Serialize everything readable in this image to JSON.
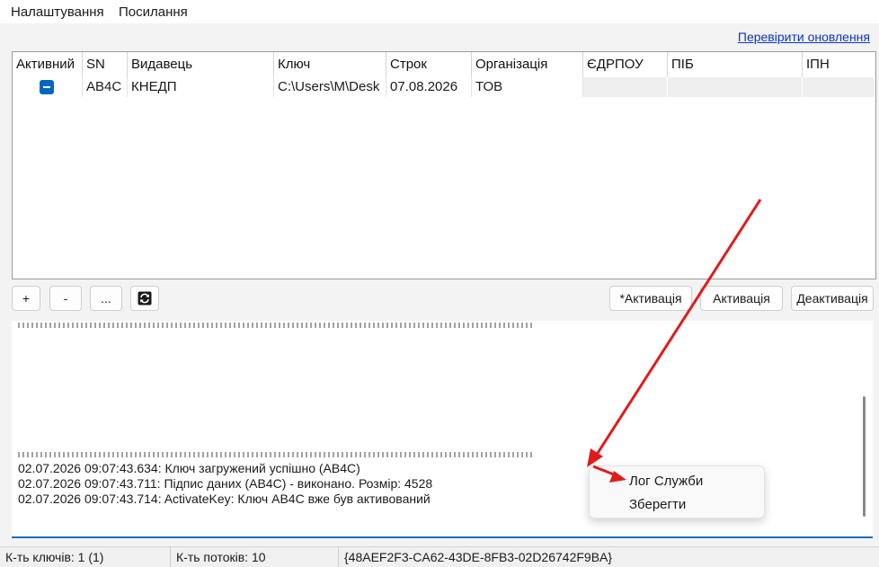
{
  "menubar": {
    "items": [
      "Налаштування",
      "Посилання"
    ]
  },
  "check_updates_link": "Перевірити оновлення",
  "table": {
    "columns": [
      "Активний",
      "SN",
      "Видавець",
      "Ключ",
      "Строк",
      "Організація",
      "ЄДРПОУ",
      "ПІБ",
      "ІПН"
    ],
    "rows": [
      {
        "sn": "AB4C",
        "issuer": "КНЕДП",
        "key": "C:\\Users\\M\\Desk",
        "expires": "07.08.2026",
        "org": "ТОВ"
      }
    ]
  },
  "buttons": {
    "add": "+",
    "remove": "-",
    "more": "...",
    "activate_star": "*Активація",
    "activate": "Активація",
    "deactivate": "Деактивація"
  },
  "log": {
    "lines": [
      "02.07.2026 09:07:43.634: Ключ загружений успішно (AB4C)",
      "02.07.2026 09:07:43.711: Підпис даних (AB4C) - виконано. Розмір: 4528",
      "02.07.2026 09:07:43.714: ActivateKey: Ключ AB4C вже був активований"
    ]
  },
  "context_menu": {
    "items": [
      "Лог Служби",
      "Зберегти"
    ]
  },
  "statusbar": {
    "keys": "К-ть ключів: 1 (1)",
    "threads": "К-ть потоків: 10",
    "guid": "{48AEF2F3-CA62-43DE-8FB3-02D26742F9BA}"
  },
  "colors": {
    "accent": "#0067c0",
    "link": "#0a34c8",
    "arrow": "#e11b1b"
  },
  "icons": {
    "refresh": "refresh-icon",
    "checkbox": "checkbox-indeterminate-icon"
  }
}
